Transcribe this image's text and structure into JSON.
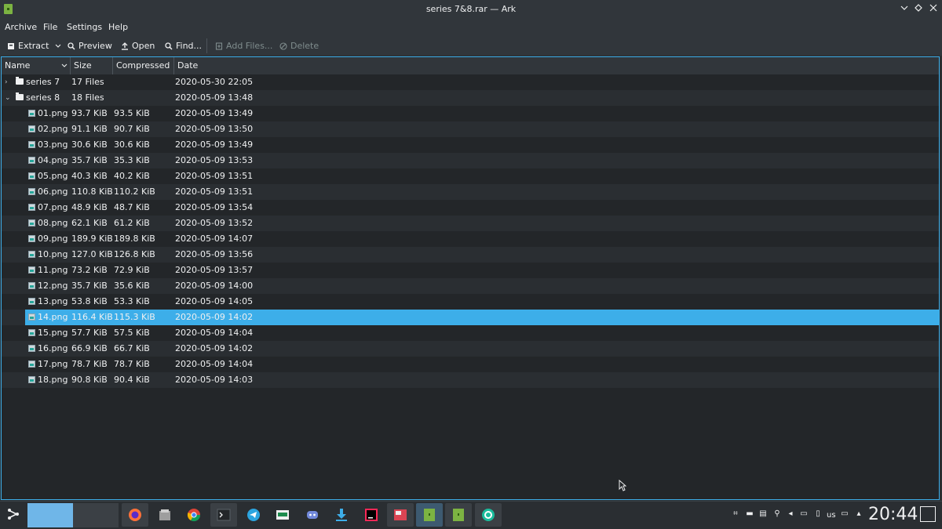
{
  "window": {
    "title": "series 7&8.rar — Ark"
  },
  "menu": [
    "Archive",
    "File",
    "Settings",
    "Help"
  ],
  "toolbar": {
    "extract": "Extract",
    "preview": "Preview",
    "open": "Open",
    "find": "Find...",
    "add_files": "Add Files...",
    "delete": "Delete"
  },
  "columns": {
    "name": "Name",
    "size": "Size",
    "compressed": "Compressed",
    "date": "Date"
  },
  "folders": [
    {
      "name": "series 7",
      "size": "17 Files",
      "compressed": "",
      "date": "2020-05-30 22:05",
      "expanded": false
    },
    {
      "name": "series 8",
      "size": "18 Files",
      "compressed": "",
      "date": "2020-05-09 13:48",
      "expanded": true
    }
  ],
  "files": [
    {
      "name": "01.png",
      "size": "93.7 KiB",
      "compressed": "93.5 KiB",
      "date": "2020-05-09 13:49"
    },
    {
      "name": "02.png",
      "size": "91.1 KiB",
      "compressed": "90.7 KiB",
      "date": "2020-05-09 13:50"
    },
    {
      "name": "03.png",
      "size": "30.6 KiB",
      "compressed": "30.6 KiB",
      "date": "2020-05-09 13:49"
    },
    {
      "name": "04.png",
      "size": "35.7 KiB",
      "compressed": "35.3 KiB",
      "date": "2020-05-09 13:53"
    },
    {
      "name": "05.png",
      "size": "40.3 KiB",
      "compressed": "40.2 KiB",
      "date": "2020-05-09 13:51"
    },
    {
      "name": "06.png",
      "size": "110.8 KiB",
      "compressed": "110.2 KiB",
      "date": "2020-05-09 13:51"
    },
    {
      "name": "07.png",
      "size": "48.9 KiB",
      "compressed": "48.7 KiB",
      "date": "2020-05-09 13:54"
    },
    {
      "name": "08.png",
      "size": "62.1 KiB",
      "compressed": "61.2 KiB",
      "date": "2020-05-09 13:52"
    },
    {
      "name": "09.png",
      "size": "189.9 KiB",
      "compressed": "189.8 KiB",
      "date": "2020-05-09 14:07"
    },
    {
      "name": "10.png",
      "size": "127.0 KiB",
      "compressed": "126.8 KiB",
      "date": "2020-05-09 13:56"
    },
    {
      "name": "11.png",
      "size": "73.2 KiB",
      "compressed": "72.9 KiB",
      "date": "2020-05-09 13:57"
    },
    {
      "name": "12.png",
      "size": "35.7 KiB",
      "compressed": "35.6 KiB",
      "date": "2020-05-09 14:00"
    },
    {
      "name": "13.png",
      "size": "53.8 KiB",
      "compressed": "53.3 KiB",
      "date": "2020-05-09 14:05"
    },
    {
      "name": "14.png",
      "size": "116.4 KiB",
      "compressed": "115.3 KiB",
      "date": "2020-05-09 14:02",
      "selected": true
    },
    {
      "name": "15.png",
      "size": "57.7 KiB",
      "compressed": "57.5 KiB",
      "date": "2020-05-09 14:04"
    },
    {
      "name": "16.png",
      "size": "66.9 KiB",
      "compressed": "66.7 KiB",
      "date": "2020-05-09 14:02"
    },
    {
      "name": "17.png",
      "size": "78.7 KiB",
      "compressed": "78.7 KiB",
      "date": "2020-05-09 14:04"
    },
    {
      "name": "18.png",
      "size": "90.8 KiB",
      "compressed": "90.4 KiB",
      "date": "2020-05-09 14:03"
    }
  ],
  "taskbar": {
    "apps": [
      "app-launcher-icon",
      "firefox-icon",
      "files-icon",
      "chrome-icon",
      "terminal-icon",
      "telegram-icon",
      "system-monitor-icon",
      "discord-icon",
      "downloads-icon",
      "jetbrains-icon",
      "screenshot-tool-icon",
      "ark-icon",
      "ark-icon",
      "settings-icon"
    ],
    "keyboard_layout": "us",
    "clock": "20:44"
  },
  "colors": {
    "selection": "#3daee9",
    "window_bg": "#31363b",
    "view_bg": "#232629",
    "text": "#eff0f1"
  }
}
